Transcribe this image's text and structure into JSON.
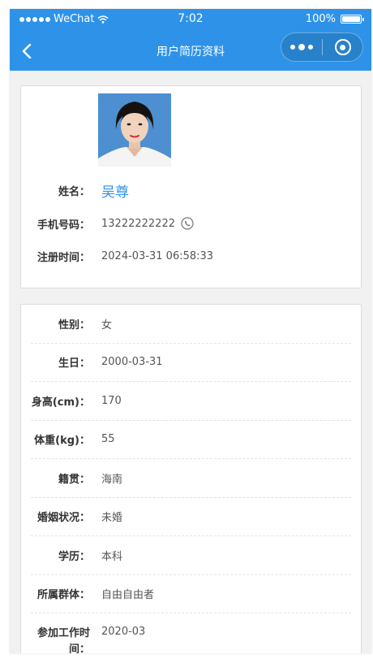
{
  "status_bar": {
    "carrier": "WeChat",
    "time": "7:02",
    "battery": "100%",
    "battery_level": 1.0
  },
  "navbar": {
    "title": "用户简历资料"
  },
  "profile": {
    "name_label": "姓名：",
    "name": "吴尊",
    "phone_label": "手机号码：",
    "phone": "13222222222",
    "registered_label": "注册时间：",
    "registered": "2024-03-31 06:58:33"
  },
  "details": [
    {
      "label": "性别：",
      "value": "女"
    },
    {
      "label": "生日：",
      "value": "2000-03-31"
    },
    {
      "label": "身高(cm)：",
      "value": "170"
    },
    {
      "label": "体重(kg)：",
      "value": "55"
    },
    {
      "label": "籍贯：",
      "value": "海南"
    },
    {
      "label": "婚姻状况：",
      "value": "未婚"
    },
    {
      "label": "学历：",
      "value": "本科"
    },
    {
      "label": "所属群体：",
      "value": "自由自由者"
    },
    {
      "label": "参加工作时间：",
      "value": "2020-03"
    }
  ],
  "colors": {
    "accent": "#2e93e8",
    "background": "#f1f1f1"
  }
}
